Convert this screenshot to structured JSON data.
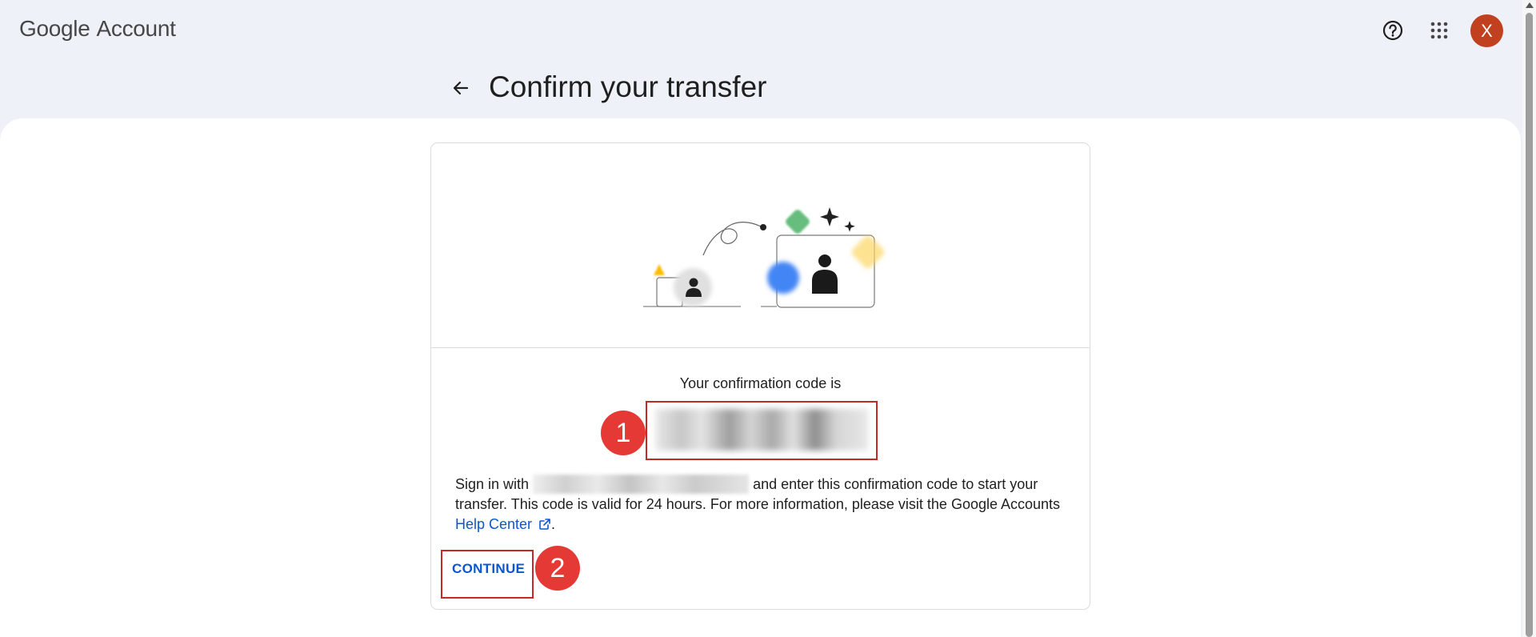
{
  "header": {
    "brand_google": "Google",
    "brand_account": "Account",
    "avatar_initial": "X",
    "icons": [
      "help-icon",
      "apps-grid-icon"
    ]
  },
  "page": {
    "title": "Confirm your transfer"
  },
  "card": {
    "code_label": "Your confirmation code is",
    "desc_before": "Sign in with",
    "desc_after": "and enter this confirmation code to start your transfer. This code is valid for 24 hours. For more information, please visit the Google Accounts",
    "help_link": "Help Center",
    "desc_end": ".",
    "continue_label": "CONTINUE"
  },
  "annotations": {
    "badge1": "1",
    "badge2": "2"
  },
  "colors": {
    "accent": "#0b57d0",
    "avatar": "#c0401f",
    "annotation_red": "#e53935"
  }
}
